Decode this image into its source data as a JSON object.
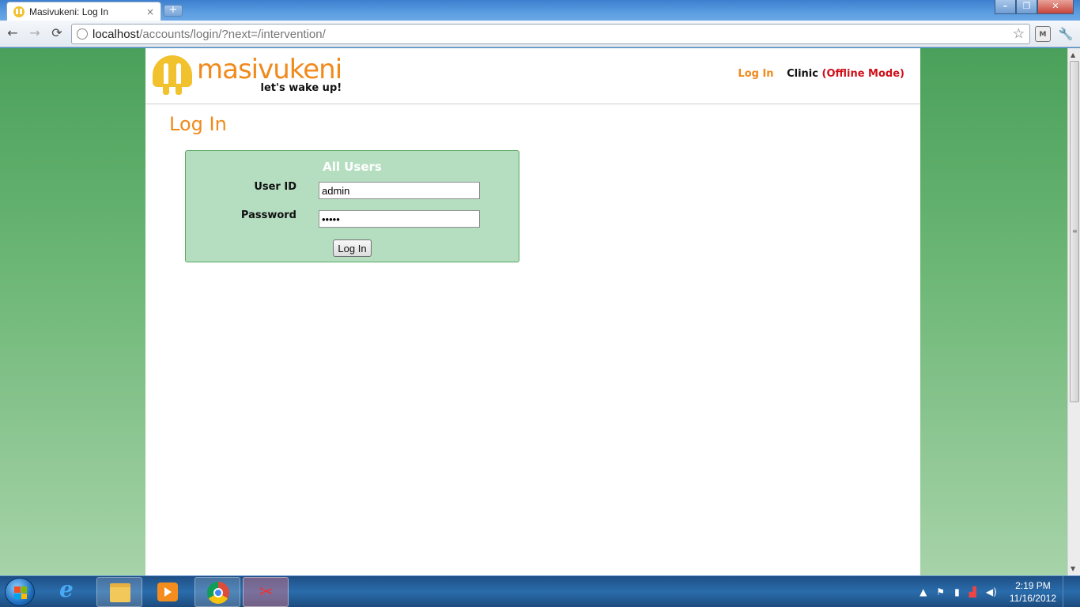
{
  "browser": {
    "tab_title": "Masivukeni: Log In",
    "tab_close": "×",
    "new_tab": "+",
    "url_host": "localhost",
    "url_path": "/accounts/login/?next=/intervention/",
    "window_buttons": {
      "minimize": "–",
      "maximize": "❐",
      "close": "✕"
    },
    "nav": {
      "back": "←",
      "forward": "→",
      "reload": "⟳",
      "bookmark": "☆",
      "wrench": "🔧"
    },
    "icons": [
      "back-icon",
      "forward-icon",
      "reload-icon",
      "globe-icon",
      "star-icon",
      "extension-icon",
      "wrench-icon"
    ]
  },
  "site": {
    "logo_word": "masivukeni",
    "logo_tagline": "let's wake up!",
    "nav_login": "Log In",
    "nav_clinic": "Clinic",
    "nav_offline": "(Offline Mode)",
    "colors": {
      "accent": "#f08a1c",
      "logo_yellow": "#f2c12e",
      "offline_red": "#d0101a",
      "box_bg": "#b5dec1",
      "box_border": "#58a85f"
    }
  },
  "login": {
    "page_title": "Log In",
    "box_title": "All Users",
    "user_label": "User ID",
    "user_value": "admin",
    "password_label": "Password",
    "password_value": "•••••",
    "submit_label": "Log In"
  },
  "taskbar": {
    "apps": [
      "start-icon",
      "internet-explorer-icon",
      "file-explorer-icon",
      "media-player-icon",
      "chrome-icon",
      "snipping-tool-icon"
    ],
    "time": "2:19 PM",
    "date": "11/16/2012",
    "tray_icons": [
      "show-hidden-icons",
      "action-center-flag-icon",
      "power-icon",
      "network-icon",
      "volume-icon"
    ]
  }
}
